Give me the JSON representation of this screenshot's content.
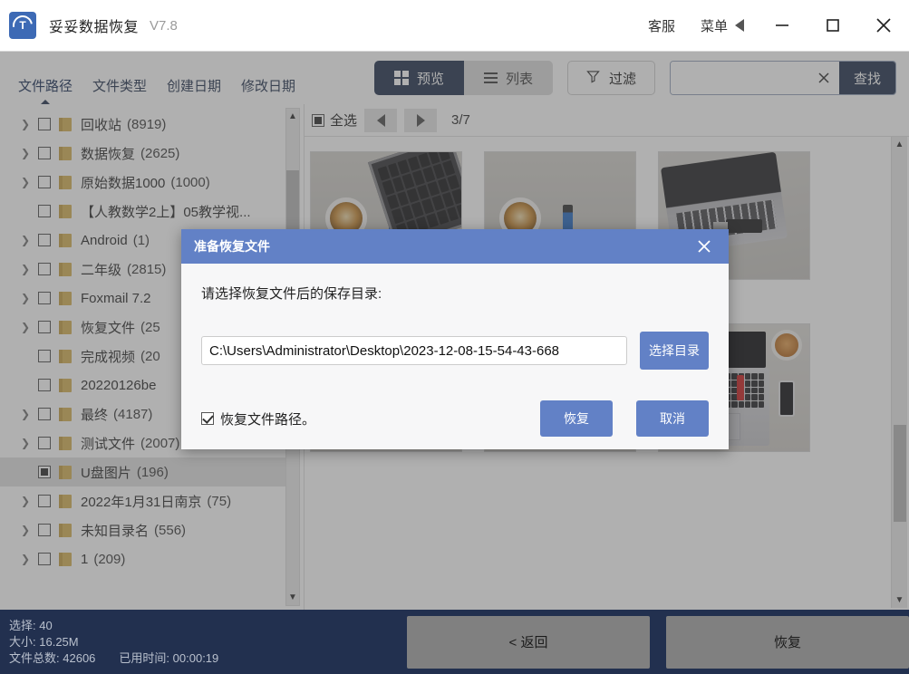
{
  "window": {
    "app_name": "妥妥数据恢复",
    "version": "V7.8",
    "logo_letter": "T",
    "support_label": "客服",
    "menu_label": "菜单",
    "minimize_icon": "minimize-icon",
    "maximize_icon": "maximize-icon",
    "close_icon": "close-icon"
  },
  "toolbar": {
    "tabs": [
      {
        "label": "文件路径",
        "active": true
      },
      {
        "label": "文件类型",
        "active": false
      },
      {
        "label": "创建日期",
        "active": false
      },
      {
        "label": "修改日期",
        "active": false
      }
    ],
    "preview_label": "预览",
    "list_label": "列表",
    "filter_label": "过滤",
    "search_value": "",
    "search_placeholder": "",
    "find_label": "查找",
    "active_view": "预览",
    "accent_dark": "#2b3a55",
    "accent_blue": "#6281c6"
  },
  "tree": {
    "items": [
      {
        "name": "回收站",
        "count": "(8919)",
        "expandable": true,
        "checked": "none",
        "selected": false
      },
      {
        "name": "数据恢复",
        "count": "(2625)",
        "expandable": true,
        "checked": "none",
        "selected": false
      },
      {
        "name": "原始数据1000",
        "count": "(1000)",
        "expandable": true,
        "checked": "none",
        "selected": false
      },
      {
        "name": "【人教数学2上】05教学视...",
        "count": "",
        "expandable": false,
        "checked": "none",
        "selected": false
      },
      {
        "name": "Android",
        "count": "(1)",
        "expandable": true,
        "checked": "none",
        "selected": false
      },
      {
        "name": "二年级",
        "count": "(2815)",
        "expandable": true,
        "checked": "none",
        "selected": false
      },
      {
        "name": "Foxmail 7.2",
        "count": "",
        "expandable": true,
        "checked": "none",
        "selected": false
      },
      {
        "name": "恢复文件",
        "count": "(25",
        "expandable": true,
        "checked": "none",
        "selected": false
      },
      {
        "name": "完成视频",
        "count": "(20",
        "expandable": false,
        "checked": "none",
        "selected": false
      },
      {
        "name": "20220126be",
        "count": "",
        "expandable": false,
        "checked": "none",
        "selected": false
      },
      {
        "name": "最终",
        "count": "(4187)",
        "expandable": true,
        "checked": "none",
        "selected": false
      },
      {
        "name": "测试文件",
        "count": "(2007)",
        "expandable": true,
        "checked": "none",
        "selected": false
      },
      {
        "name": "U盘图片",
        "count": "(196)",
        "expandable": false,
        "checked": "partial",
        "selected": true
      },
      {
        "name": "2022年1月31日南京",
        "count": "(75)",
        "expandable": true,
        "checked": "none",
        "selected": false
      },
      {
        "name": "未知目录名",
        "count": "(556)",
        "expandable": true,
        "checked": "none",
        "selected": false
      },
      {
        "name": "1",
        "count": "(209)",
        "expandable": true,
        "checked": "none",
        "selected": false
      }
    ]
  },
  "content": {
    "select_all_label": "全选",
    "select_all_state": "partial",
    "prev_icon": "previous-page-icon",
    "next_icon": "next-page-icon",
    "page_indicator": "3/7",
    "row1_captions": [
      "",
      "",
      ""
    ],
    "row2_captions": [
      "",
      "",
      ""
    ]
  },
  "dialog": {
    "title": "准备恢复文件",
    "close_icon": "close-icon",
    "prompt": "请选择恢复文件后的保存目录:",
    "path_value": "C:\\Users\\Administrator\\Desktop\\2023-12-08-15-54-43-668",
    "choose_dir_label": "选择目录",
    "checkbox_label": "恢复文件路径。",
    "checkbox_checked": true,
    "recover_label": "恢复",
    "cancel_label": "取消"
  },
  "status": {
    "selected_label": "选择:",
    "selected_value": "40",
    "size_label": "大小:",
    "size_value": "16.25M",
    "total_label": "文件总数:",
    "total_value": "42606",
    "elapsed_label": "已用时间:",
    "elapsed_value": "00:00:19",
    "back_label": "< 返回",
    "recover_label": "恢复",
    "bar_color": "#22304f"
  }
}
